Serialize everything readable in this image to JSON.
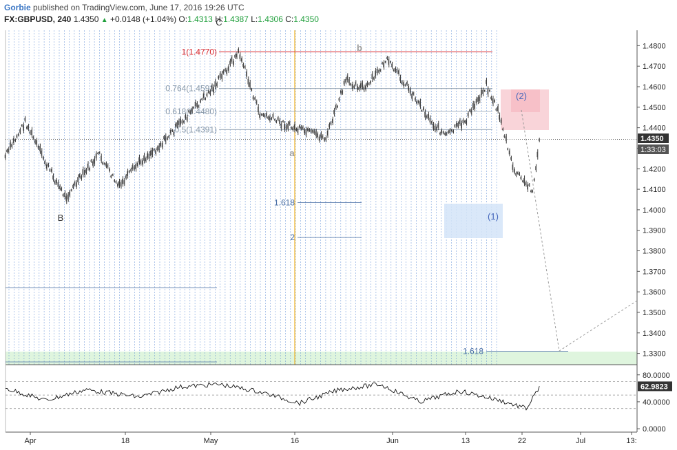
{
  "header": {
    "author": "Gorbie",
    "published": " published on TradingView.com, June 17, 2016 19:26 UTC",
    "symbol": "FX:GBPUSD, 240",
    "last": "1.4350",
    "change": "+0.0148 (+1.04%)",
    "open_label": "O:",
    "open": "1.4313",
    "high_label": "H:",
    "high": "1.4387",
    "low_label": "L:",
    "low": "1.4306",
    "close_label": "C:",
    "close": "1.4350"
  },
  "colors": {
    "bull": "#1e9e3a",
    "fib_red": "#d9262b",
    "fib_gray": "#8899aa",
    "vline": "#4a7fd0",
    "orange": "#f0b020",
    "pink": "#f7c6cc",
    "lightblue": "#d4e4f8",
    "green_zone": "#dff5de",
    "wave_blue": "#4466bb",
    "price_tag": "#333333"
  },
  "chart_data": [
    {
      "type": "line",
      "name": "price",
      "x": [
        "Mar 29",
        "Apr 1",
        "Apr 4",
        "Apr 7",
        "Apr 12",
        "Apr 15",
        "Apr 18",
        "Apr 21",
        "Apr 25",
        "Apr 29",
        "May 3",
        "May 6",
        "May 11",
        "May 16",
        "May 19",
        "May 22",
        "May 25",
        "May 28",
        "Jun 1",
        "Jun 3",
        "Jun 6",
        "Jun 9",
        "Jun 11",
        "Jun 13",
        "Jun 15",
        "Jun 16",
        "Jun 17"
      ],
      "y": [
        1.426,
        1.443,
        1.423,
        1.406,
        1.427,
        1.411,
        1.423,
        1.431,
        1.445,
        1.459,
        1.477,
        1.447,
        1.44,
        1.435,
        1.463,
        1.459,
        1.473,
        1.461,
        1.442,
        1.436,
        1.444,
        1.461,
        1.446,
        1.42,
        1.412,
        1.41,
        1.435
      ],
      "ylim": [
        1.3245,
        1.4875
      ],
      "y_ticks": [
        "1.4800",
        "1.4700",
        "1.4600",
        "1.4500",
        "1.4400",
        "1.4300",
        "1.4200",
        "1.4100",
        "1.4000",
        "1.3900",
        "1.3800",
        "1.3700",
        "1.3600",
        "1.3500",
        "1.3400",
        "1.3300"
      ],
      "x_ticks": [
        "Apr",
        "18",
        "May",
        "16",
        "Jun",
        "13",
        "22",
        "Jul",
        "13:"
      ],
      "last_price_label": "1.4350",
      "countdown_label": "1:33:03",
      "fib_levels": [
        {
          "label": "1(1.4770)",
          "value": 1.477,
          "color": "#d9262b"
        },
        {
          "label": "0.764(1.4591)",
          "value": 1.4591,
          "color": "#8899aa"
        },
        {
          "label": "0.618(1.4480)",
          "value": 1.448,
          "color": "#8899aa"
        },
        {
          "label": "0.5(1.4391)",
          "value": 1.4391,
          "color": "#8899aa"
        }
      ],
      "extension_levels": [
        {
          "label": "1.618",
          "value": 1.4035
        },
        {
          "label": "2",
          "value": 1.3865
        },
        {
          "label": "1.618",
          "value": 1.331
        }
      ],
      "wave_labels": [
        "B",
        "C",
        "a",
        "b",
        "(1)",
        "(2)"
      ]
    },
    {
      "type": "line",
      "name": "oscillator",
      "x": [
        "Mar 29",
        "Apr 4",
        "Apr 10",
        "Apr 18",
        "Apr 24",
        "Apr 30",
        "May 6",
        "May 12",
        "May 18",
        "May 24",
        "May 30",
        "Jun 5",
        "Jun 11",
        "Jun 15",
        "Jun 17"
      ],
      "y": [
        60,
        42,
        58,
        47,
        62,
        66,
        55,
        38,
        58,
        66,
        40,
        56,
        42,
        30,
        62.98
      ],
      "ylim": [
        -5,
        92
      ],
      "y_ticks": [
        "80.0000",
        "40.0000",
        "0.0000"
      ],
      "guides": [
        70,
        50,
        30
      ],
      "last_value_label": "62.9823"
    }
  ]
}
